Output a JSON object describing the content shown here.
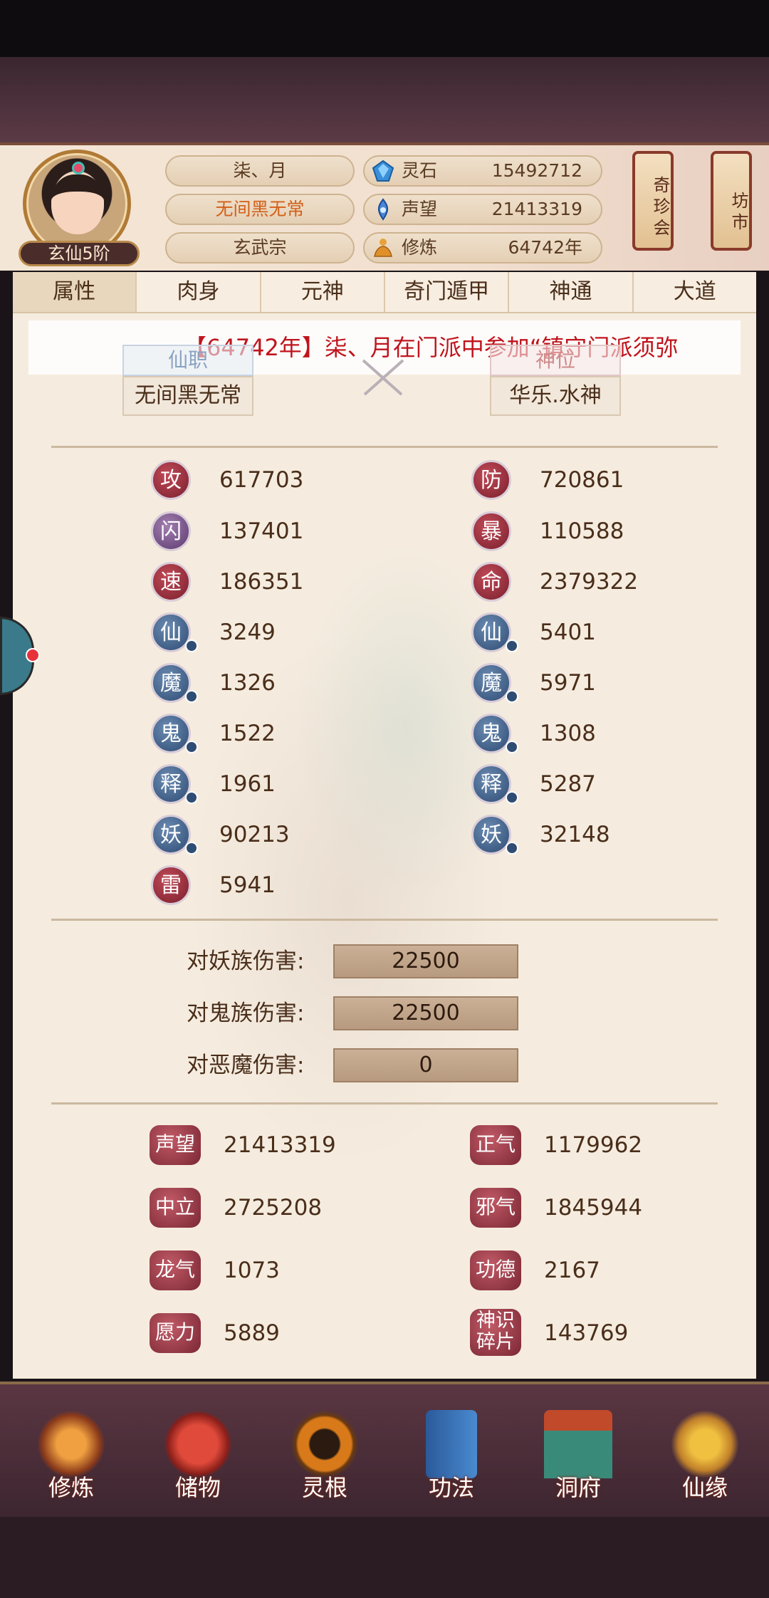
{
  "player": {
    "name": "柒、月",
    "title": "无间黑无常",
    "sect": "玄武宗",
    "rank": "玄仙5阶"
  },
  "resources": [
    {
      "label": "灵石",
      "value": "15492712",
      "icon": "spirit-stone-icon"
    },
    {
      "label": "声望",
      "value": "21413319",
      "icon": "reputation-icon"
    },
    {
      "label": "修炼",
      "value": "64742年",
      "icon": "cultivation-icon"
    }
  ],
  "side_buttons": [
    {
      "label": "奇珍会"
    },
    {
      "label": "坊市"
    }
  ],
  "tabs": [
    "属性",
    "肉身",
    "元神",
    "奇门遁甲",
    "神通",
    "大道"
  ],
  "marquee": "【64742年】柒、月在门派中参加“镇守门派须弥",
  "position": {
    "xianzhi_label": "仙职",
    "xianzhi_value": "无间黑无常",
    "shenwei_label": "神位",
    "shenwei_value": "华乐.水神"
  },
  "stats_left": [
    {
      "icon": "攻",
      "value": "617703"
    },
    {
      "icon": "闪",
      "value": "137401"
    },
    {
      "icon": "速",
      "value": "186351"
    },
    {
      "icon": "仙",
      "value": "3249"
    },
    {
      "icon": "魔",
      "value": "1326"
    },
    {
      "icon": "鬼",
      "value": "1522"
    },
    {
      "icon": "释",
      "value": "1961"
    },
    {
      "icon": "妖",
      "value": "90213"
    },
    {
      "icon": "雷",
      "value": "5941"
    }
  ],
  "stats_right": [
    {
      "icon": "防",
      "value": "720861"
    },
    {
      "icon": "暴",
      "value": "110588"
    },
    {
      "icon": "命",
      "value": "2379322"
    },
    {
      "icon": "仙",
      "value": "5401"
    },
    {
      "icon": "魔",
      "value": "5971"
    },
    {
      "icon": "鬼",
      "value": "1308"
    },
    {
      "icon": "释",
      "value": "5287"
    },
    {
      "icon": "妖",
      "value": "32148"
    }
  ],
  "damage": [
    {
      "label": "对妖族伤害:",
      "value": "22500"
    },
    {
      "label": "对鬼族伤害:",
      "value": "22500"
    },
    {
      "label": "对恶魔伤害:",
      "value": "0"
    }
  ],
  "reputation_left": [
    {
      "icon": "声望",
      "value": "21413319"
    },
    {
      "icon": "中立",
      "value": "2725208"
    },
    {
      "icon": "龙气",
      "value": "1073"
    },
    {
      "icon": "愿力",
      "value": "5889"
    }
  ],
  "reputation_right": [
    {
      "icon": "正气",
      "value": "1179962"
    },
    {
      "icon": "邪气",
      "value": "1845944"
    },
    {
      "icon": "功德",
      "value": "2167"
    },
    {
      "icon": "神识碎片",
      "value": "143769"
    }
  ],
  "nav": [
    "修炼",
    "储物",
    "灵根",
    "功法",
    "洞府",
    "仙缘"
  ],
  "colors": {
    "accent_red": "#c0141d",
    "panel_bg": "#f5ecdf",
    "frame": "#3d2630"
  }
}
